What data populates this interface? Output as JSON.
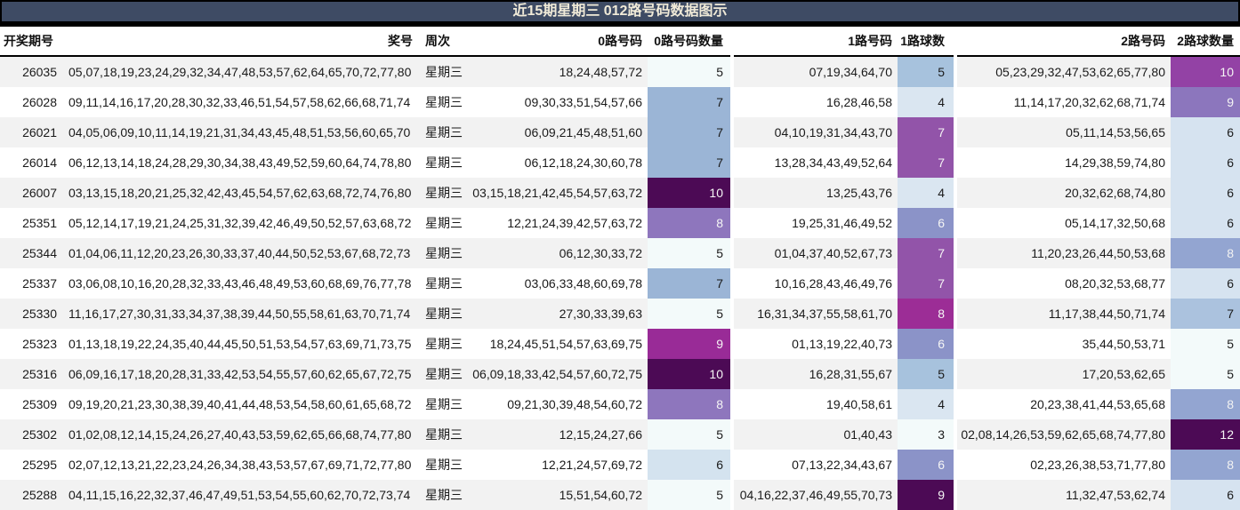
{
  "title": "近15期星期三 012路号码数据图示",
  "colors": {
    "title_bar_bg": "#3e4b64",
    "title_text": "#f0ead8",
    "frame": "#000000",
    "row_alt_bg": "#f2f2f2",
    "row_base_bg": "#ffffff",
    "body_text": "#1a1a1a"
  },
  "color_scales": {
    "road0_count": {
      "5": {
        "bg": "#f3fafa",
        "fg": "#1a1a1a"
      },
      "6": {
        "bg": "#d4e3ef",
        "fg": "#1a1a1a"
      },
      "7": {
        "bg": "#9bb5d6",
        "fg": "#1a1a1a"
      },
      "8": {
        "bg": "#8e76bd",
        "fg": "#f5f5f5"
      },
      "9": {
        "bg": "#992b97",
        "fg": "#f5f5f5"
      },
      "10": {
        "bg": "#4c0a55",
        "fg": "#f5f5f5"
      }
    },
    "road1_count": {
      "3": {
        "bg": "#f3fafa",
        "fg": "#1a1a1a"
      },
      "4": {
        "bg": "#dae6f1",
        "fg": "#1a1a1a"
      },
      "5": {
        "bg": "#a7c2dd",
        "fg": "#1a1a1a"
      },
      "6": {
        "bg": "#8b93c8",
        "fg": "#f5f5f5"
      },
      "7": {
        "bg": "#9254a9",
        "fg": "#f5f5f5"
      },
      "8": {
        "bg": "#9c2d96",
        "fg": "#f5f5f5"
      },
      "9": {
        "bg": "#4c0a55",
        "fg": "#f5f5f5"
      }
    },
    "road2_count": {
      "5": {
        "bg": "#f3fafa",
        "fg": "#1a1a1a"
      },
      "6": {
        "bg": "#d6e3f0",
        "fg": "#1a1a1a"
      },
      "7": {
        "bg": "#abc2de",
        "fg": "#1a1a1a"
      },
      "8": {
        "bg": "#93a5d1",
        "fg": "#f2f2f2"
      },
      "9": {
        "bg": "#8c76bd",
        "fg": "#f5f5f5"
      },
      "10": {
        "bg": "#9342a5",
        "fg": "#f5f5f5"
      },
      "12": {
        "bg": "#4c0a55",
        "fg": "#f5f5f5"
      }
    }
  },
  "chart_data": {
    "type": "table",
    "title": "近15期星期三 012路号码数据图示",
    "columns": [
      "开奖期号",
      "奖号",
      "周次",
      "0路号码",
      "0路号码数量",
      "1路号码",
      "1路球数",
      "2路号码",
      "2路球数量"
    ],
    "rows": [
      [
        "26035",
        "05,07,18,19,23,24,29,32,34,47,48,53,57,62,64,65,70,72,77,80",
        "星期三",
        "18,24,48,57,72",
        5,
        "07,19,34,64,70",
        5,
        "05,23,29,32,47,53,62,65,77,80",
        10
      ],
      [
        "26028",
        "09,11,14,16,17,20,28,30,32,33,46,51,54,57,58,62,66,68,71,74",
        "星期三",
        "09,30,33,51,54,57,66",
        7,
        "16,28,46,58",
        4,
        "11,14,17,20,32,62,68,71,74",
        9
      ],
      [
        "26021",
        "04,05,06,09,10,11,14,19,21,31,34,43,45,48,51,53,56,60,65,70",
        "星期三",
        "06,09,21,45,48,51,60",
        7,
        "04,10,19,31,34,43,70",
        7,
        "05,11,14,53,56,65",
        6
      ],
      [
        "26014",
        "06,12,13,14,18,24,28,29,30,34,38,43,49,52,59,60,64,74,78,80",
        "星期三",
        "06,12,18,24,30,60,78",
        7,
        "13,28,34,43,49,52,64",
        7,
        "14,29,38,59,74,80",
        6
      ],
      [
        "26007",
        "03,13,15,18,20,21,25,32,42,43,45,54,57,62,63,68,72,74,76,80",
        "星期三",
        "03,15,18,21,42,45,54,57,63,72",
        10,
        "13,25,43,76",
        4,
        "20,32,62,68,74,80",
        6
      ],
      [
        "25351",
        "05,12,14,17,19,21,24,25,31,32,39,42,46,49,50,52,57,63,68,72",
        "星期三",
        "12,21,24,39,42,57,63,72",
        8,
        "19,25,31,46,49,52",
        6,
        "05,14,17,32,50,68",
        6
      ],
      [
        "25344",
        "01,04,06,11,12,20,23,26,30,33,37,40,44,50,52,53,67,68,72,73",
        "星期三",
        "06,12,30,33,72",
        5,
        "01,04,37,40,52,67,73",
        7,
        "11,20,23,26,44,50,53,68",
        8
      ],
      [
        "25337",
        "03,06,08,10,16,20,28,32,33,43,46,48,49,53,60,68,69,76,77,78",
        "星期三",
        "03,06,33,48,60,69,78",
        7,
        "10,16,28,43,46,49,76",
        7,
        "08,20,32,53,68,77",
        6
      ],
      [
        "25330",
        "11,16,17,27,30,31,33,34,37,38,39,44,50,55,58,61,63,70,71,74",
        "星期三",
        "27,30,33,39,63",
        5,
        "16,31,34,37,55,58,61,70",
        8,
        "11,17,38,44,50,71,74",
        7
      ],
      [
        "25323",
        "01,13,18,19,22,24,35,40,44,45,50,51,53,54,57,63,69,71,73,75",
        "星期三",
        "18,24,45,51,54,57,63,69,75",
        9,
        "01,13,19,22,40,73",
        6,
        "35,44,50,53,71",
        5
      ],
      [
        "25316",
        "06,09,16,17,18,20,28,31,33,42,53,54,55,57,60,62,65,67,72,75",
        "星期三",
        "06,09,18,33,42,54,57,60,72,75",
        10,
        "16,28,31,55,67",
        5,
        "17,20,53,62,65",
        5
      ],
      [
        "25309",
        "09,19,20,21,23,30,38,39,40,41,44,48,53,54,58,60,61,65,68,72",
        "星期三",
        "09,21,30,39,48,54,60,72",
        8,
        "19,40,58,61",
        4,
        "20,23,38,41,44,53,65,68",
        8
      ],
      [
        "25302",
        "01,02,08,12,14,15,24,26,27,40,43,53,59,62,65,66,68,74,77,80",
        "星期三",
        "12,15,24,27,66",
        5,
        "01,40,43",
        3,
        "02,08,14,26,53,59,62,65,68,74,77,80",
        12
      ],
      [
        "25295",
        "02,07,12,13,21,22,23,24,26,34,38,43,53,57,67,69,71,72,77,80",
        "星期三",
        "12,21,24,57,69,72",
        6,
        "07,13,22,34,43,67",
        6,
        "02,23,26,38,53,71,77,80",
        8
      ],
      [
        "25288",
        "04,11,15,16,22,32,37,46,47,49,51,53,54,55,60,62,70,72,73,74",
        "星期三",
        "15,51,54,60,72",
        5,
        "04,16,22,37,46,49,55,70,73",
        9,
        "11,32,47,53,62,74",
        6
      ]
    ]
  }
}
